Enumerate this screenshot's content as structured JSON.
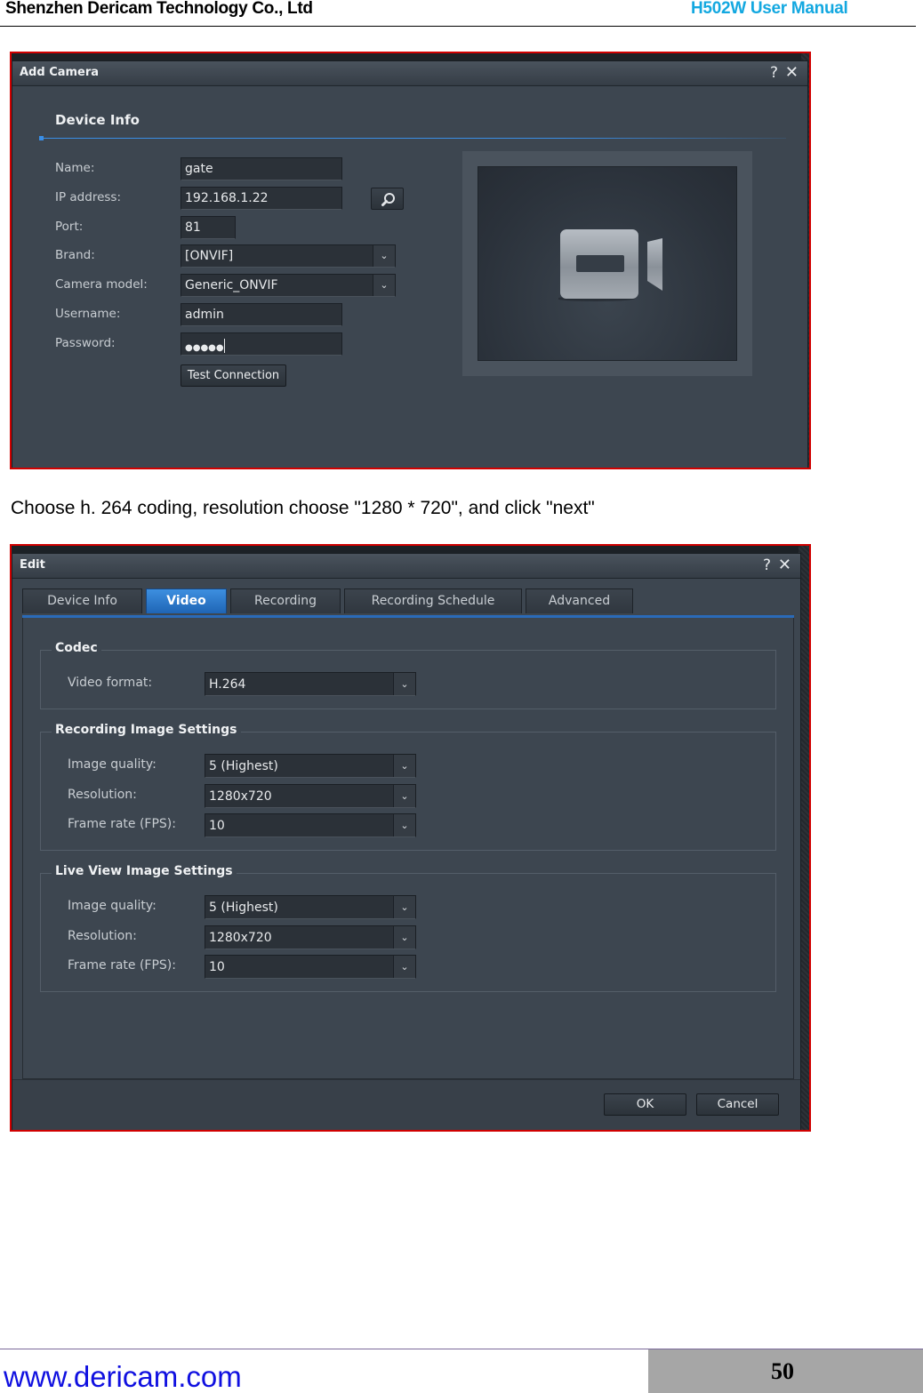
{
  "document": {
    "company": "Shenzhen Dericam Technology Co., Ltd",
    "manual_title": "H502W User Manual",
    "caption": "Choose h. 264 coding, resolution choose \"1280 * 720\", and click \"next\"",
    "footer_url": "www.dericam.com",
    "page_number": "50",
    "accent_color": "#13a8e0",
    "frame_color": "#d00000"
  },
  "add_camera_dialog": {
    "title": "Add Camera",
    "help_glyph": "?",
    "close_glyph": "✕",
    "section_title": "Device Info",
    "fields": {
      "name": {
        "label": "Name:",
        "value": "gate"
      },
      "ip_address": {
        "label": "IP address:",
        "value": "192.168.1.22"
      },
      "port": {
        "label": "Port:",
        "value": "81"
      },
      "brand": {
        "label": "Brand:",
        "value": "[ONVIF]"
      },
      "camera_model": {
        "label": "Camera model:",
        "value": "Generic_ONVIF"
      },
      "username": {
        "label": "Username:",
        "value": "admin"
      },
      "password": {
        "label": "Password:",
        "value": "●●●●●"
      }
    },
    "search_icon": "magnifier-icon",
    "test_connection_label": "Test Connection",
    "preview_icon": "video-camera-icon"
  },
  "edit_dialog": {
    "title": "Edit",
    "help_glyph": "?",
    "close_glyph": "✕",
    "tabs": [
      {
        "label": "Device Info",
        "active": false
      },
      {
        "label": "Video",
        "active": true
      },
      {
        "label": "Recording",
        "active": false
      },
      {
        "label": "Recording Schedule",
        "active": false
      },
      {
        "label": "Advanced",
        "active": false
      }
    ],
    "codec": {
      "title": "Codec",
      "video_format": {
        "label": "Video format:",
        "value": "H.264"
      }
    },
    "recording_image": {
      "title": "Recording Image Settings",
      "image_quality": {
        "label": "Image quality:",
        "value": "5 (Highest)"
      },
      "resolution": {
        "label": "Resolution:",
        "value": "1280x720"
      },
      "frame_rate": {
        "label": "Frame rate (FPS):",
        "value": "10"
      }
    },
    "live_view_image": {
      "title": "Live View Image Settings",
      "image_quality": {
        "label": "Image quality:",
        "value": "5 (Highest)"
      },
      "resolution": {
        "label": "Resolution:",
        "value": "1280x720"
      },
      "frame_rate": {
        "label": "Frame rate (FPS):",
        "value": "10"
      }
    },
    "ok_label": "OK",
    "cancel_label": "Cancel",
    "active_tab_color": "#2a6ab8"
  },
  "dropdown_glyph": "⌄"
}
